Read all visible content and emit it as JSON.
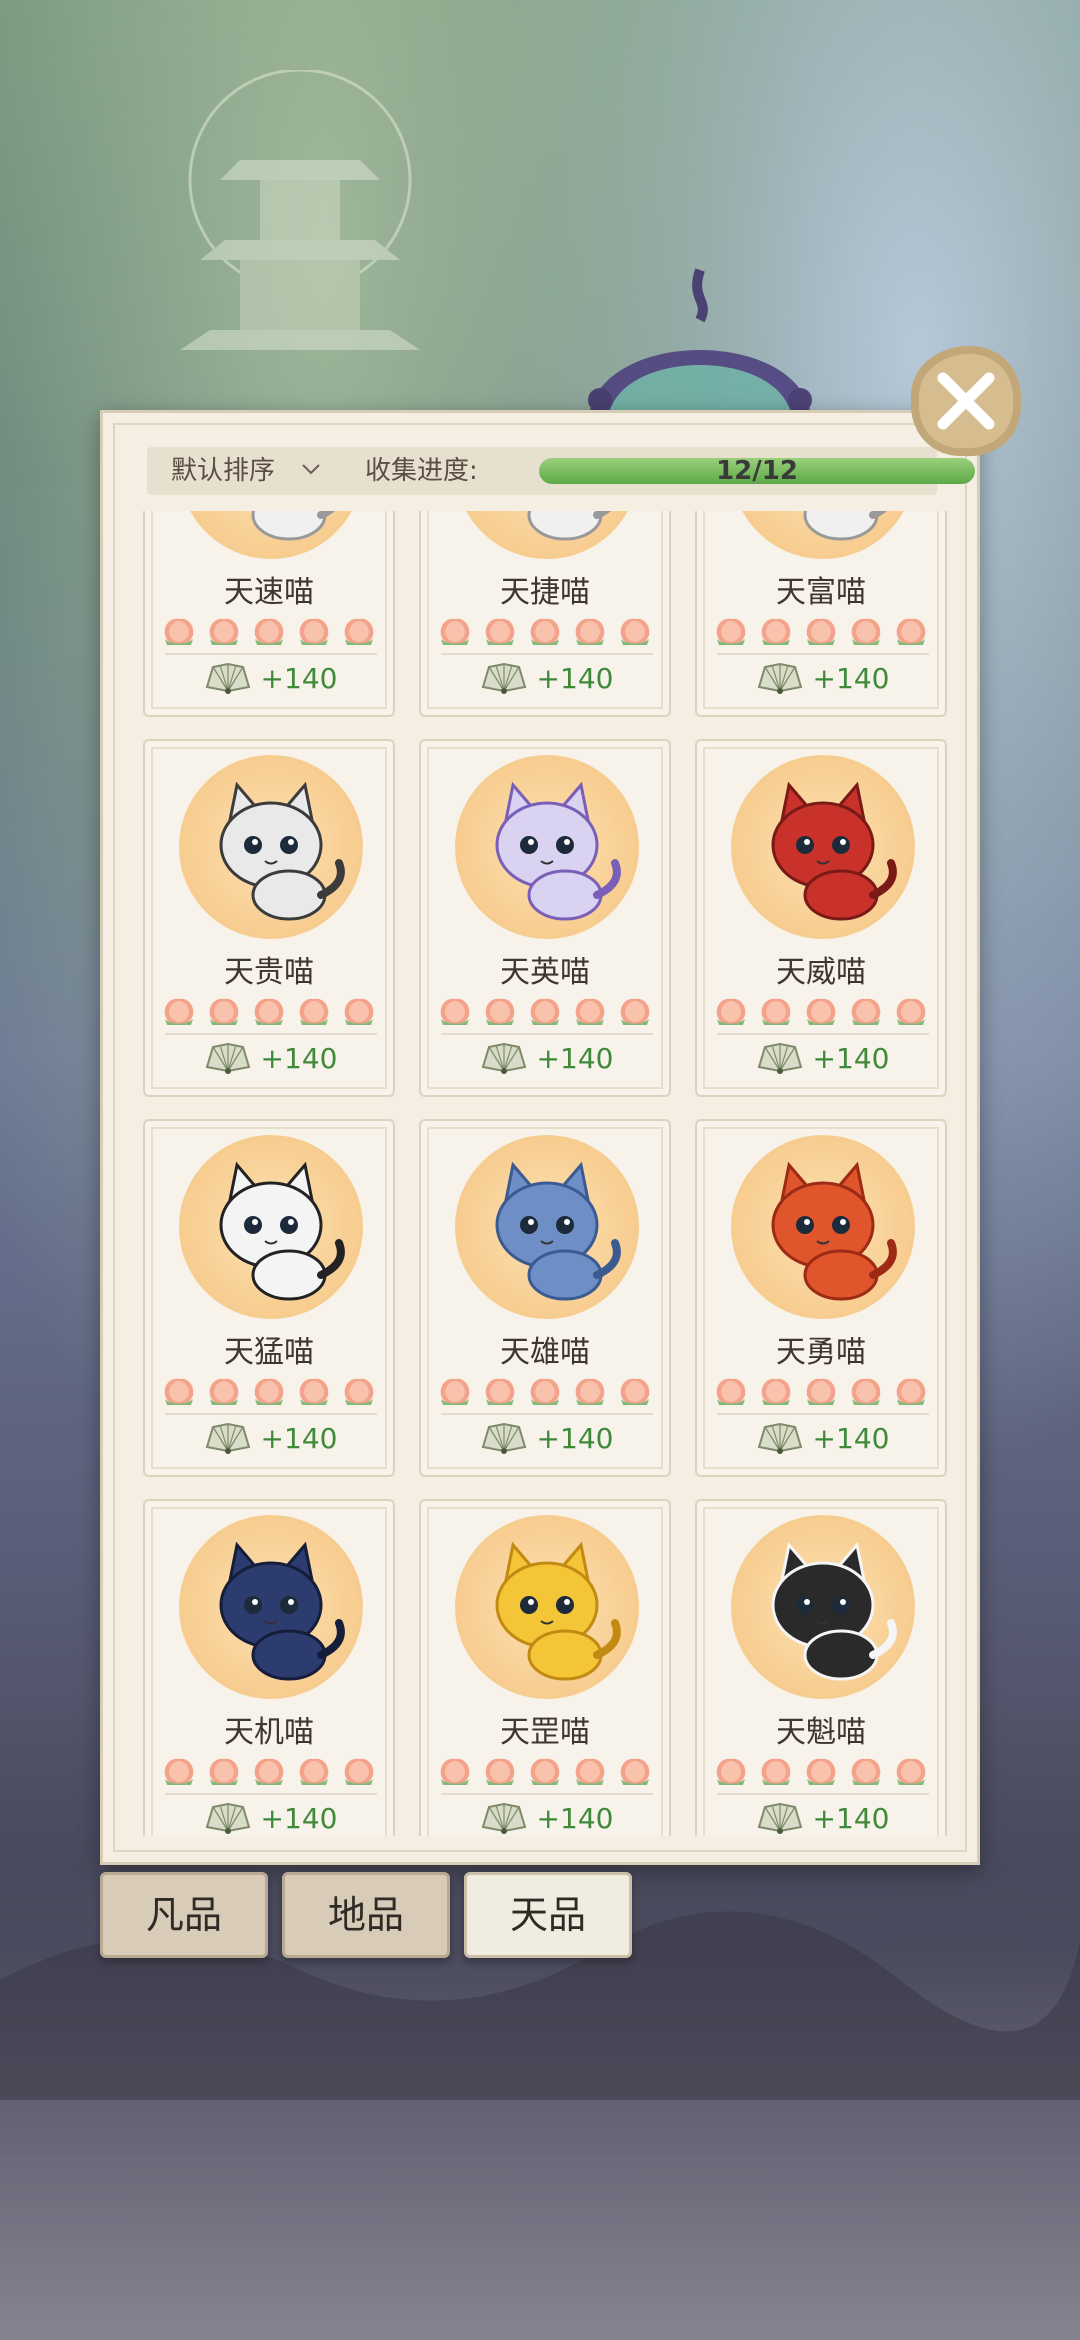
{
  "toolbar": {
    "sort_label": "默认排序",
    "progress_label": "收集进度:",
    "progress_text": "12/12",
    "progress_fraction": 1.0
  },
  "cards": [
    {
      "name": "天速喵",
      "reward": "+140",
      "stars": 5,
      "colors": [
        "#f0f0f0",
        "#999999"
      ]
    },
    {
      "name": "天捷喵",
      "reward": "+140",
      "stars": 5,
      "colors": [
        "#f0f0f0",
        "#999999"
      ]
    },
    {
      "name": "天富喵",
      "reward": "+140",
      "stars": 5,
      "colors": [
        "#f0f0f0",
        "#999999"
      ]
    },
    {
      "name": "天贵喵",
      "reward": "+140",
      "stars": 5,
      "colors": [
        "#e9e9e9",
        "#3b3b3b"
      ]
    },
    {
      "name": "天英喵",
      "reward": "+140",
      "stars": 5,
      "colors": [
        "#d9d2f0",
        "#7a5fb8"
      ]
    },
    {
      "name": "天威喵",
      "reward": "+140",
      "stars": 5,
      "colors": [
        "#c8322a",
        "#7a1a16"
      ]
    },
    {
      "name": "天猛喵",
      "reward": "+140",
      "stars": 5,
      "colors": [
        "#f4f4f4",
        "#222222"
      ]
    },
    {
      "name": "天雄喵",
      "reward": "+140",
      "stars": 5,
      "colors": [
        "#6e8fc6",
        "#3c5a92"
      ]
    },
    {
      "name": "天勇喵",
      "reward": "+140",
      "stars": 5,
      "colors": [
        "#e0552b",
        "#9c2a14"
      ]
    },
    {
      "name": "天机喵",
      "reward": "+140",
      "stars": 5,
      "colors": [
        "#2c3c6e",
        "#151d3a"
      ]
    },
    {
      "name": "天罡喵",
      "reward": "+140",
      "stars": 5,
      "colors": [
        "#f4c637",
        "#c28a12"
      ]
    },
    {
      "name": "天魁喵",
      "reward": "+140",
      "stars": 5,
      "colors": [
        "#2a2a2a",
        "#f5f5f5"
      ]
    }
  ],
  "tabs": [
    {
      "label": "凡品",
      "active": false
    },
    {
      "label": "地品",
      "active": false
    },
    {
      "label": "天品",
      "active": true
    }
  ],
  "icons": {
    "close": "close-icon",
    "sort": "chevron-down-icon",
    "star": "peach-icon",
    "reward": "fan-icon"
  }
}
